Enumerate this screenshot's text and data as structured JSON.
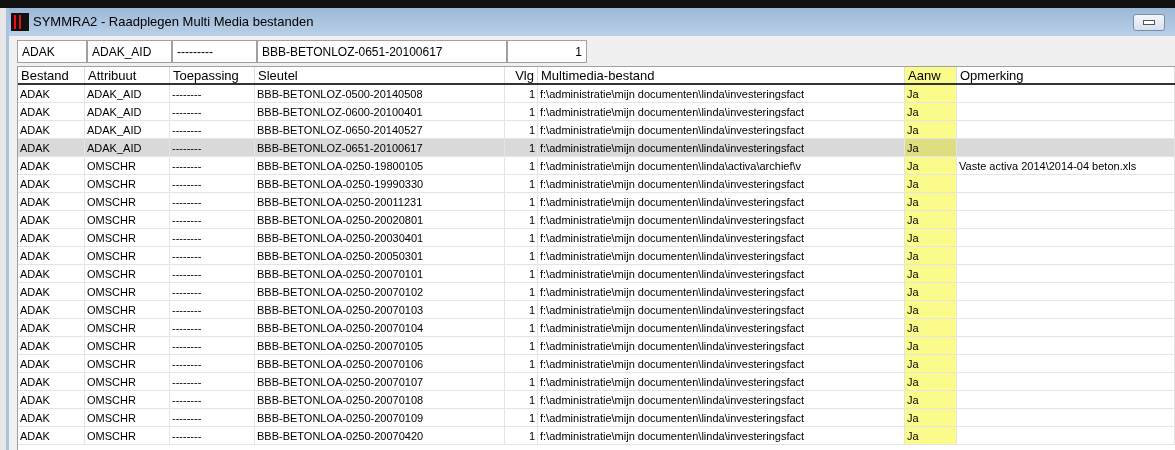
{
  "window": {
    "title": "SYMMRA2 - Raadplegen Multi Media bestanden"
  },
  "filter": [
    "ADAK",
    "ADAK_AID",
    "---------",
    "BBB-BETONLOZ-0651-20100617",
    "1"
  ],
  "table": {
    "columns": [
      "Bestand",
      "Attribuut",
      "Toepassing",
      "Sleutel",
      "Vlg",
      "Multimedia-bestand",
      "Aanw",
      "Opmerking"
    ],
    "rows": [
      {
        "selected": false,
        "cells": [
          "ADAK",
          "ADAK_AID",
          "--------",
          "BBB-BETONLOZ-0500-20140508",
          "1",
          "f:\\administratie\\mijn documenten\\linda\\investeringsfact",
          "Ja",
          ""
        ]
      },
      {
        "selected": false,
        "cells": [
          "ADAK",
          "ADAK_AID",
          "--------",
          "BBB-BETONLOZ-0600-20100401",
          "1",
          "f:\\administratie\\mijn documenten\\linda\\investeringsfact",
          "Ja",
          ""
        ]
      },
      {
        "selected": false,
        "cells": [
          "ADAK",
          "ADAK_AID",
          "--------",
          "BBB-BETONLOZ-0650-20140527",
          "1",
          "f:\\administratie\\mijn documenten\\linda\\investeringsfact",
          "Ja",
          ""
        ]
      },
      {
        "selected": true,
        "cells": [
          "ADAK",
          "ADAK_AID",
          "--------",
          "BBB-BETONLOZ-0651-20100617",
          "1",
          "f:\\administratie\\mijn documenten\\linda\\investeringsfact",
          "Ja",
          ""
        ]
      },
      {
        "selected": false,
        "cells": [
          "ADAK",
          "OMSCHR",
          "--------",
          "BBB-BETONLOA-0250-19800105",
          "1",
          "f:\\administratie\\mijn documenten\\linda\\activa\\archief\\v",
          "Ja",
          "Vaste activa 2014\\2014-04 beton.xls"
        ]
      },
      {
        "selected": false,
        "cells": [
          "ADAK",
          "OMSCHR",
          "--------",
          "BBB-BETONLOA-0250-19990330",
          "1",
          "f:\\administratie\\mijn documenten\\linda\\investeringsfact",
          "Ja",
          ""
        ]
      },
      {
        "selected": false,
        "cells": [
          "ADAK",
          "OMSCHR",
          "--------",
          "BBB-BETONLOA-0250-20011231",
          "1",
          "f:\\administratie\\mijn documenten\\linda\\investeringsfact",
          "Ja",
          ""
        ]
      },
      {
        "selected": false,
        "cells": [
          "ADAK",
          "OMSCHR",
          "--------",
          "BBB-BETONLOA-0250-20020801",
          "1",
          "f:\\administratie\\mijn documenten\\linda\\investeringsfact",
          "Ja",
          ""
        ]
      },
      {
        "selected": false,
        "cells": [
          "ADAK",
          "OMSCHR",
          "--------",
          "BBB-BETONLOA-0250-20030401",
          "1",
          "f:\\administratie\\mijn documenten\\linda\\investeringsfact",
          "Ja",
          ""
        ]
      },
      {
        "selected": false,
        "cells": [
          "ADAK",
          "OMSCHR",
          "--------",
          "BBB-BETONLOA-0250-20050301",
          "1",
          "f:\\administratie\\mijn documenten\\linda\\investeringsfact",
          "Ja",
          ""
        ]
      },
      {
        "selected": false,
        "cells": [
          "ADAK",
          "OMSCHR",
          "--------",
          "BBB-BETONLOA-0250-20070101",
          "1",
          "f:\\administratie\\mijn documenten\\linda\\investeringsfact",
          "Ja",
          ""
        ]
      },
      {
        "selected": false,
        "cells": [
          "ADAK",
          "OMSCHR",
          "--------",
          "BBB-BETONLOA-0250-20070102",
          "1",
          "f:\\administratie\\mijn documenten\\linda\\investeringsfact",
          "Ja",
          ""
        ]
      },
      {
        "selected": false,
        "cells": [
          "ADAK",
          "OMSCHR",
          "--------",
          "BBB-BETONLOA-0250-20070103",
          "1",
          "f:\\administratie\\mijn documenten\\linda\\investeringsfact",
          "Ja",
          ""
        ]
      },
      {
        "selected": false,
        "cells": [
          "ADAK",
          "OMSCHR",
          "--------",
          "BBB-BETONLOA-0250-20070104",
          "1",
          "f:\\administratie\\mijn documenten\\linda\\investeringsfact",
          "Ja",
          ""
        ]
      },
      {
        "selected": false,
        "cells": [
          "ADAK",
          "OMSCHR",
          "--------",
          "BBB-BETONLOA-0250-20070105",
          "1",
          "f:\\administratie\\mijn documenten\\linda\\investeringsfact",
          "Ja",
          ""
        ]
      },
      {
        "selected": false,
        "cells": [
          "ADAK",
          "OMSCHR",
          "--------",
          "BBB-BETONLOA-0250-20070106",
          "1",
          "f:\\administratie\\mijn documenten\\linda\\investeringsfact",
          "Ja",
          ""
        ]
      },
      {
        "selected": false,
        "cells": [
          "ADAK",
          "OMSCHR",
          "--------",
          "BBB-BETONLOA-0250-20070107",
          "1",
          "f:\\administratie\\mijn documenten\\linda\\investeringsfact",
          "Ja",
          ""
        ]
      },
      {
        "selected": false,
        "cells": [
          "ADAK",
          "OMSCHR",
          "--------",
          "BBB-BETONLOA-0250-20070108",
          "1",
          "f:\\administratie\\mijn documenten\\linda\\investeringsfact",
          "Ja",
          ""
        ]
      },
      {
        "selected": false,
        "cells": [
          "ADAK",
          "OMSCHR",
          "--------",
          "BBB-BETONLOA-0250-20070109",
          "1",
          "f:\\administratie\\mijn documenten\\linda\\investeringsfact",
          "Ja",
          ""
        ]
      },
      {
        "selected": false,
        "cells": [
          "ADAK",
          "OMSCHR",
          "--------",
          "BBB-BETONLOA-0250-20070420",
          "1",
          "f:\\administratie\\mijn documenten\\linda\\investeringsfact",
          "Ja",
          ""
        ]
      }
    ]
  }
}
